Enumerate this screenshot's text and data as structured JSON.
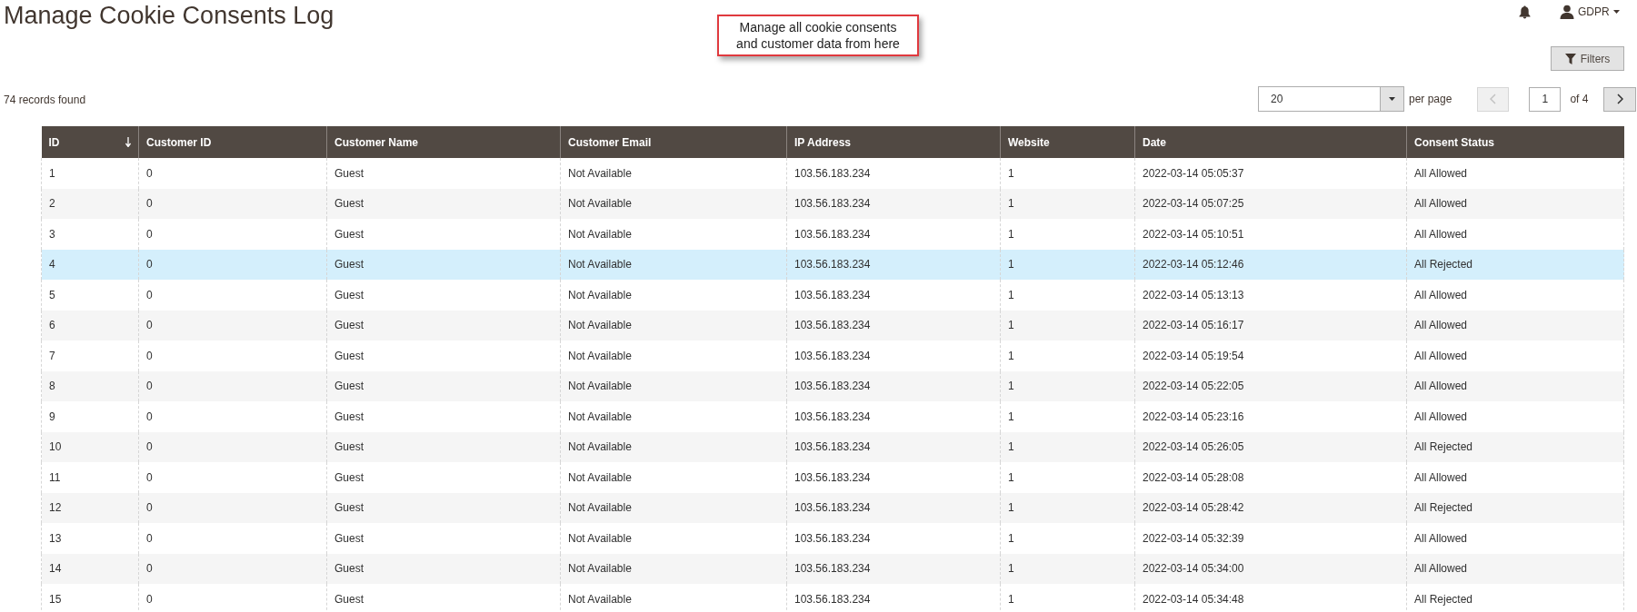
{
  "page_title": "Manage Cookie Consents Log",
  "callout": {
    "lines": [
      "Manage all cookie consents",
      "and customer data from here"
    ]
  },
  "header": {
    "user": "GDPR"
  },
  "filters_button": "Filters",
  "records_found": "74 records found",
  "pagination": {
    "per_page_value": "20",
    "per_page_label": "per page",
    "page": "1",
    "of_pages": "of 4"
  },
  "table": {
    "columns": [
      {
        "label": "ID",
        "sorted": true
      },
      {
        "label": "Customer ID",
        "sorted": false
      },
      {
        "label": "Customer Name",
        "sorted": false
      },
      {
        "label": "Customer Email",
        "sorted": false
      },
      {
        "label": "IP Address",
        "sorted": false
      },
      {
        "label": "Website",
        "sorted": false
      },
      {
        "label": "Date",
        "sorted": false
      },
      {
        "label": "Consent Status",
        "sorted": false
      }
    ],
    "rows": [
      {
        "selected": false,
        "cells": [
          "1",
          "0",
          "Guest",
          "Not Available",
          "103.56.183.234",
          "1",
          "2022-03-14 05:05:37",
          "All Allowed"
        ]
      },
      {
        "selected": false,
        "cells": [
          "2",
          "0",
          "Guest",
          "Not Available",
          "103.56.183.234",
          "1",
          "2022-03-14 05:07:25",
          "All Allowed"
        ]
      },
      {
        "selected": false,
        "cells": [
          "3",
          "0",
          "Guest",
          "Not Available",
          "103.56.183.234",
          "1",
          "2022-03-14 05:10:51",
          "All Allowed"
        ]
      },
      {
        "selected": true,
        "cells": [
          "4",
          "0",
          "Guest",
          "Not Available",
          "103.56.183.234",
          "1",
          "2022-03-14 05:12:46",
          "All Rejected"
        ]
      },
      {
        "selected": false,
        "cells": [
          "5",
          "0",
          "Guest",
          "Not Available",
          "103.56.183.234",
          "1",
          "2022-03-14 05:13:13",
          "All Allowed"
        ]
      },
      {
        "selected": false,
        "cells": [
          "6",
          "0",
          "Guest",
          "Not Available",
          "103.56.183.234",
          "1",
          "2022-03-14 05:16:17",
          "All Allowed"
        ]
      },
      {
        "selected": false,
        "cells": [
          "7",
          "0",
          "Guest",
          "Not Available",
          "103.56.183.234",
          "1",
          "2022-03-14 05:19:54",
          "All Allowed"
        ]
      },
      {
        "selected": false,
        "cells": [
          "8",
          "0",
          "Guest",
          "Not Available",
          "103.56.183.234",
          "1",
          "2022-03-14 05:22:05",
          "All Allowed"
        ]
      },
      {
        "selected": false,
        "cells": [
          "9",
          "0",
          "Guest",
          "Not Available",
          "103.56.183.234",
          "1",
          "2022-03-14 05:23:16",
          "All Allowed"
        ]
      },
      {
        "selected": false,
        "cells": [
          "10",
          "0",
          "Guest",
          "Not Available",
          "103.56.183.234",
          "1",
          "2022-03-14 05:26:05",
          "All Rejected"
        ]
      },
      {
        "selected": false,
        "cells": [
          "11",
          "0",
          "Guest",
          "Not Available",
          "103.56.183.234",
          "1",
          "2022-03-14 05:28:08",
          "All Allowed"
        ]
      },
      {
        "selected": false,
        "cells": [
          "12",
          "0",
          "Guest",
          "Not Available",
          "103.56.183.234",
          "1",
          "2022-03-14 05:28:42",
          "All Rejected"
        ]
      },
      {
        "selected": false,
        "cells": [
          "13",
          "0",
          "Guest",
          "Not Available",
          "103.56.183.234",
          "1",
          "2022-03-14 05:32:39",
          "All Allowed"
        ]
      },
      {
        "selected": false,
        "cells": [
          "14",
          "0",
          "Guest",
          "Not Available",
          "103.56.183.234",
          "1",
          "2022-03-14 05:34:00",
          "All Allowed"
        ]
      },
      {
        "selected": false,
        "cells": [
          "15",
          "0",
          "Guest",
          "Not Available",
          "103.56.183.234",
          "1",
          "2022-03-14 05:34:48",
          "All Rejected"
        ]
      }
    ]
  }
}
